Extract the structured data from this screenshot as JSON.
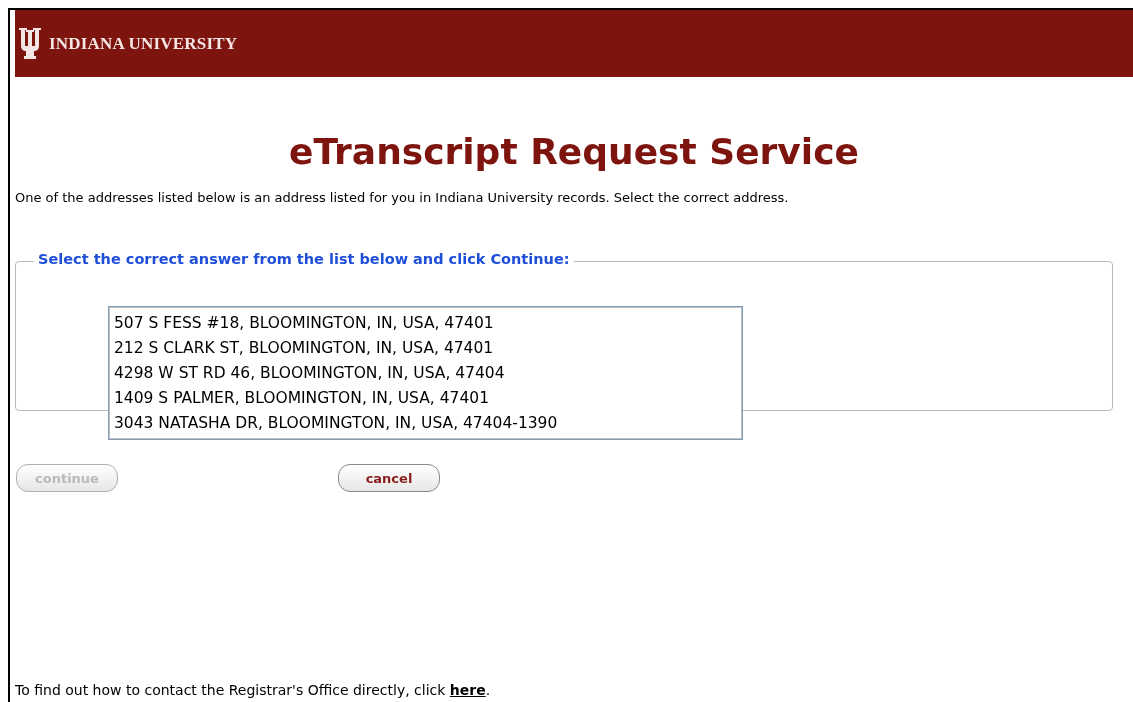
{
  "header": {
    "wordmark": "INDIANA UNIVERSITY"
  },
  "title": "eTranscript Request Service",
  "intro": "One of the addresses listed below is an address listed for you in Indiana University records. Select the correct address.",
  "fieldset": {
    "legend": "Select the correct answer from the list below and click Continue:",
    "options": [
      {
        "label": "507 S FESS #18, BLOOMINGTON, IN, USA, 47401",
        "selected": false
      },
      {
        "label": "212 S CLARK ST, BLOOMINGTON, IN, USA, 47401",
        "selected": false
      },
      {
        "label": "4298 W ST RD 46, BLOOMINGTON, IN, USA, 47404",
        "selected": false
      },
      {
        "label": "1409 S PALMER, BLOOMINGTON, IN, USA, 47401",
        "selected": false
      },
      {
        "label": "3043 NATASHA DR, BLOOMINGTON, IN, USA, 47404-1390",
        "selected": false
      }
    ]
  },
  "buttons": [
    {
      "label": "continue",
      "disabled": true
    },
    {
      "label": "cancel",
      "disabled": false
    }
  ],
  "footer": {
    "text_before": "To find out how to contact the Registrar's Office directly, click ",
    "link": "here",
    "text_after": "."
  }
}
